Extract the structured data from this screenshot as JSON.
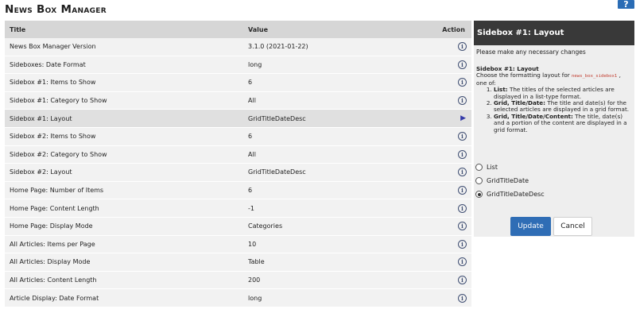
{
  "page": {
    "title": "News Box Manager",
    "help_label": "?"
  },
  "table": {
    "headers": {
      "title": "Title",
      "value": "Value",
      "action": "Action"
    },
    "rows": [
      {
        "title": "News Box Manager Version",
        "value": "3.1.0 (2021-01-22)"
      },
      {
        "title": "Sideboxes: Date Format",
        "value": "long"
      },
      {
        "title": "Sidebox #1: Items to Show",
        "value": "6"
      },
      {
        "title": "Sidebox #1: Category to Show",
        "value": "All"
      },
      {
        "title": "Sidebox #1: Layout",
        "value": "GridTitleDateDesc",
        "selected": true
      },
      {
        "title": "Sidebox #2: Items to Show",
        "value": "6"
      },
      {
        "title": "Sidebox #2: Category to Show",
        "value": "All"
      },
      {
        "title": "Sidebox #2: Layout",
        "value": "GridTitleDateDesc"
      },
      {
        "title": "Home Page: Number of Items",
        "value": "6"
      },
      {
        "title": "Home Page: Content Length",
        "value": "-1"
      },
      {
        "title": "Home Page: Display Mode",
        "value": "Categories"
      },
      {
        "title": "All Articles: Items per Page",
        "value": "10"
      },
      {
        "title": "All Articles: Display Mode",
        "value": "Table"
      },
      {
        "title": "All Articles: Content Length",
        "value": "200"
      },
      {
        "title": "Article Display: Date Format",
        "value": "long"
      }
    ]
  },
  "sidebox": {
    "header": "Sidebox #1: Layout",
    "intro": "Please make any necessary changes",
    "info_title": "Sidebox #1: Layout",
    "desc_prefix": "Choose the formatting layout for",
    "config_key": "news_box_sidebox1",
    "desc_suffix": ", one of:",
    "options_desc": [
      {
        "label": "List:",
        "text": "The titles of the selected articles are displayed in a list-type format."
      },
      {
        "label": "Grid, Title/Date:",
        "text": "The title and date(s) for the selected articles are displayed in a grid format."
      },
      {
        "label": "Grid, Title/Date/Content:",
        "text": "The title, date(s) and a portion of the content are displayed in a grid format."
      }
    ],
    "radio_options": [
      "List",
      "GridTitleDate",
      "GridTitleDateDesc"
    ],
    "selected_option": "GridTitleDateDesc",
    "update_label": "Update",
    "cancel_label": "Cancel"
  },
  "icons": {
    "info": "info-icon",
    "arrow": "arrow-right-icon"
  },
  "colors": {
    "header_dark": "#393939",
    "accent_blue": "#2f6db5",
    "selected_row": "#e0e0e0"
  }
}
